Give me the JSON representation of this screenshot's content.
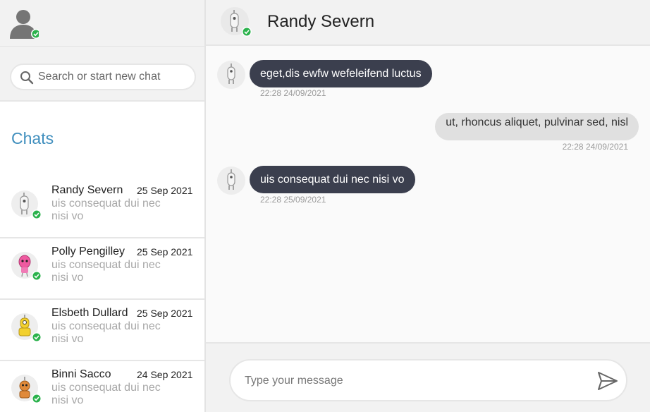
{
  "search": {
    "placeholder": "Search or start new chat"
  },
  "chats_title": "Chats",
  "chats": [
    {
      "name": "Randy Severn",
      "date": "25 Sep 2021",
      "preview": "uis consequat dui nec nisi vo",
      "avatar": "robot-grey-icon"
    },
    {
      "name": "Polly Pengilley",
      "date": "25 Sep 2021",
      "preview": "uis consequat dui nec nisi vo",
      "avatar": "robot-pink-icon"
    },
    {
      "name": "Elsbeth Dullard",
      "date": "25 Sep 2021",
      "preview": "uis consequat dui nec nisi vo",
      "avatar": "robot-yellow-icon"
    },
    {
      "name": "Binni Sacco",
      "date": "24 Sep 2021",
      "preview": "uis consequat dui nec nisi vo",
      "avatar": "robot-orange-icon"
    }
  ],
  "conversation": {
    "title": "Randy Severn",
    "messages": [
      {
        "direction": "in",
        "text": "eget,dis ewfw wefeleifend luctus",
        "time": "22:28 24/09/2021"
      },
      {
        "direction": "out",
        "text": "ut, rhoncus aliquet, pulvinar sed, nisl",
        "time": "22:28 24/09/2021"
      },
      {
        "direction": "in",
        "text": "uis consequat dui nec nisi vo",
        "time": "22:28 25/09/2021"
      }
    ]
  },
  "composer": {
    "placeholder": "Type your message"
  },
  "colors": {
    "accent": "#3f8ebd",
    "bubble_in": "#3b3f4e",
    "bubble_out": "#e0e0e0",
    "online": "#2bb24c"
  }
}
